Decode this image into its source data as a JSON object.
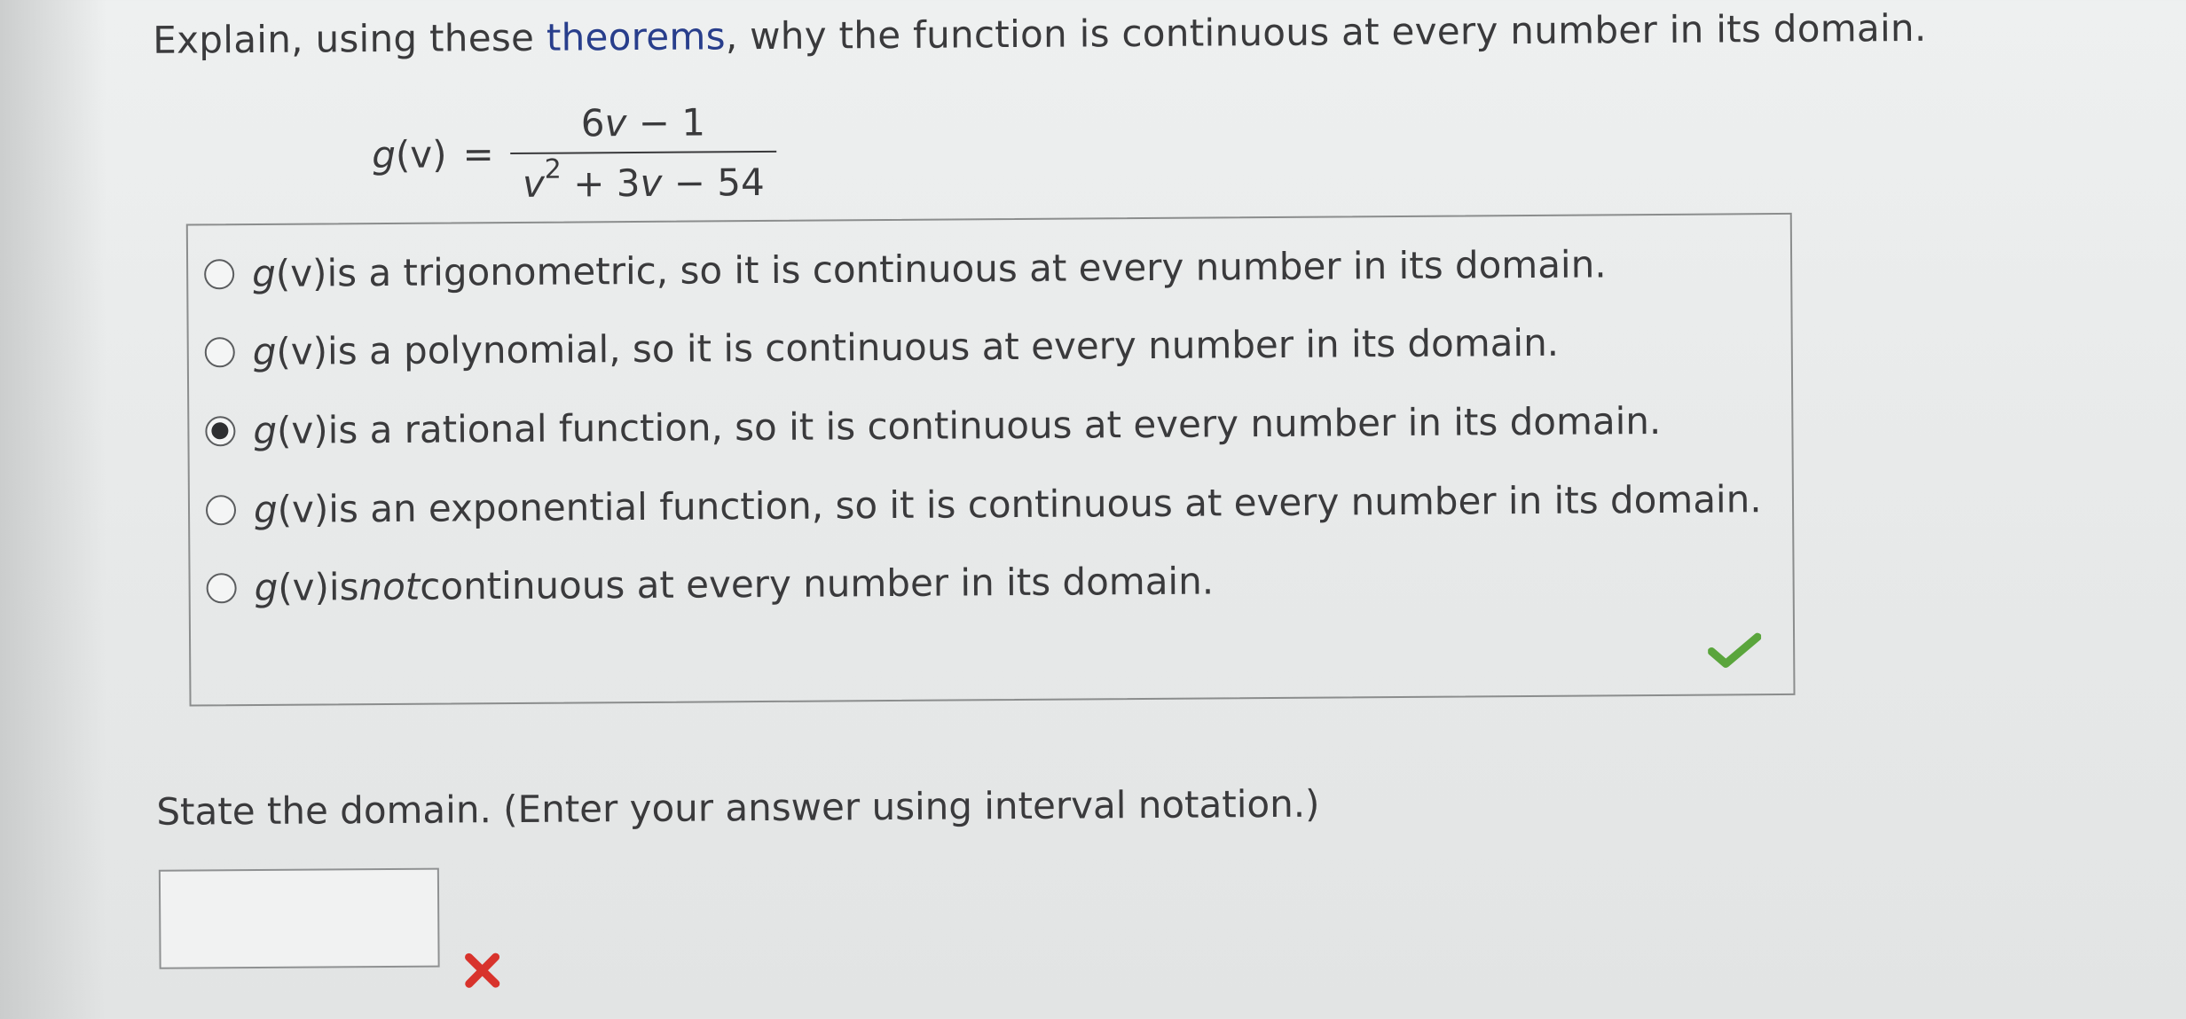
{
  "question": {
    "prompt_before_link": "Explain, using these ",
    "prompt_link": "theorems",
    "prompt_after_link": ", why the function is continuous at every number in its domain."
  },
  "equation": {
    "lhs_fn": "g",
    "lhs_arg": "(v)",
    "equals": "=",
    "numerator_coef": "6",
    "numerator_var": "v",
    "numerator_rest": " − 1",
    "denominator_var1": "v",
    "denominator_exp": "2",
    "denominator_mid": " + 3",
    "denominator_var2": "v",
    "denominator_rest": " − 54"
  },
  "choices": [
    {
      "fn": "g",
      "arg": "(v)",
      "text": " is a trigonometric, so it is continuous at every number in its domain.",
      "selected": false
    },
    {
      "fn": "g",
      "arg": "(v)",
      "text": " is a polynomial, so it is continuous at every number in its domain.",
      "selected": false
    },
    {
      "fn": "g",
      "arg": "(v)",
      "text": " is a rational function, so it is continuous at every number in its domain.",
      "selected": true
    },
    {
      "fn": "g",
      "arg": "(v)",
      "text": " is an exponential function, so it is continuous at every number in its domain.",
      "selected": false
    },
    {
      "fn": "g",
      "arg": "(v)",
      "text_before": " is ",
      "emphasis": "not",
      "text_after": " continuous at every number in its domain.",
      "selected": false
    }
  ],
  "feedback": {
    "choices_result": "correct",
    "domain_result": "incorrect",
    "check_color": "#5aa53c",
    "x_color": "#d8332c"
  },
  "domain": {
    "prompt": "State the domain. (Enter your answer using interval notation.)",
    "value": ""
  }
}
